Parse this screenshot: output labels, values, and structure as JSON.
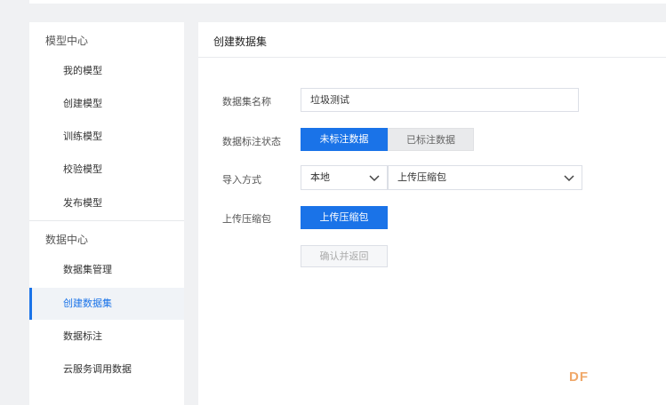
{
  "sidebar": {
    "groups": [
      {
        "title": "模型中心",
        "items": [
          "我的模型",
          "创建模型",
          "训练模型",
          "校验模型",
          "发布模型"
        ]
      },
      {
        "title": "数据中心",
        "items": [
          "数据集管理",
          "创建数据集",
          "数据标注",
          "云服务调用数据"
        ]
      }
    ],
    "active_item": "创建数据集"
  },
  "main": {
    "title": "创建数据集",
    "form": {
      "name_label": "数据集名称",
      "name_value": "垃圾测试",
      "status_label": "数据标注状态",
      "status_options": [
        "未标注数据",
        "已标注数据"
      ],
      "status_selected": "未标注数据",
      "import_label": "导入方式",
      "import_source": "本地",
      "import_type": "上传压缩包",
      "upload_label": "上传压缩包",
      "upload_button": "上传压缩包",
      "confirm_button": "确认并返回"
    }
  },
  "watermark": "DF",
  "colors": {
    "primary": "#1a73e8",
    "watermark": "#f0a86a"
  },
  "icons": {
    "select_arrow": "chevron-down-icon"
  }
}
